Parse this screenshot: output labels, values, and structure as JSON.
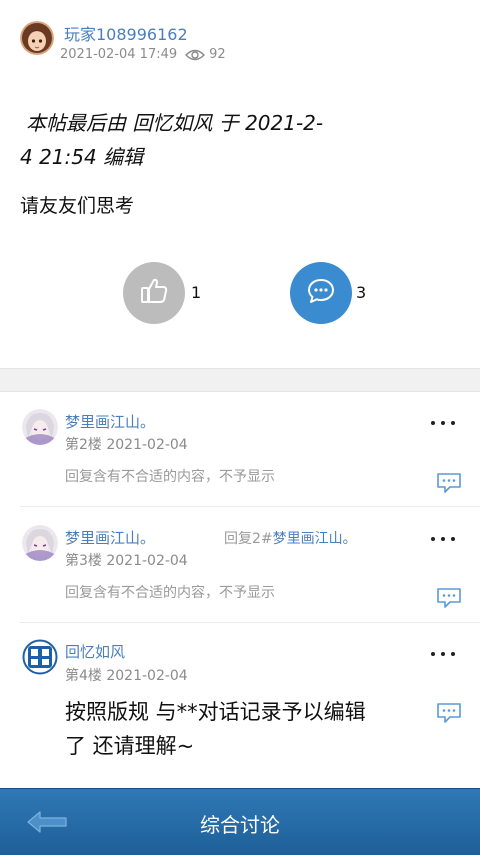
{
  "post": {
    "author": "玩家108996162",
    "datetime": "2021-02-04 17:49",
    "views": "92",
    "edit_note_line1": "本帖最后由 回忆如风 于 2021-2-",
    "edit_note_line2": "4 21:54 编辑",
    "body": "请友友们思考",
    "like_count": "1",
    "comment_count": "3"
  },
  "replies": [
    {
      "name": "梦里画江山。",
      "floor_date": "第2楼  2021-02-04",
      "content": "回复含有不合适的内容，不予显示"
    },
    {
      "name": "梦里画江山。",
      "reply_to_prefix": "回复2#",
      "reply_to_name": "梦里画江山。",
      "floor_date": "第3楼  2021-02-04",
      "content": "回复含有不合适的内容，不予显示"
    },
    {
      "name": "回忆如风",
      "floor_date": "第4楼  2021-02-04",
      "content_line1": "按照版规 与**对话记录予以编辑",
      "content_line2": "了 还请理解~"
    }
  ],
  "bottom_bar": {
    "title": "综合讨论"
  },
  "colors": {
    "accent_blue": "#2f79b6",
    "like_gray": "#bcbcbc",
    "comment_blue": "#3b8bd0",
    "link_blue": "#4a7fbf"
  },
  "icons": {
    "views": "eye-icon",
    "like": "thumbs-up-icon",
    "comment": "speech-bubble-icon",
    "reply": "reply-bubble-icon",
    "more": "more-dots-icon",
    "back": "back-arrow-icon"
  }
}
